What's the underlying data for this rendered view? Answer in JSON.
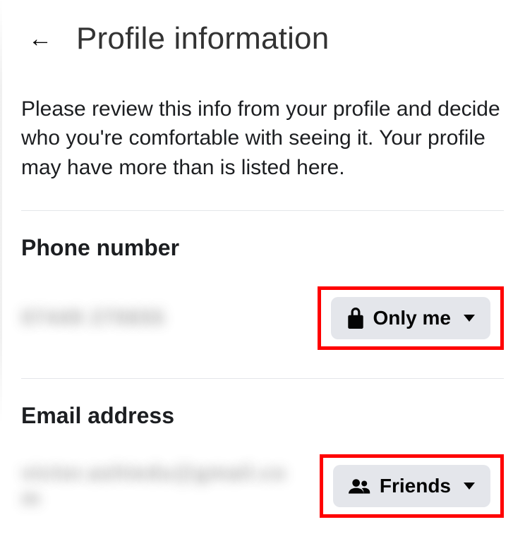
{
  "header": {
    "back": "←",
    "title": "Profile information"
  },
  "description": "Please review this info from your profile and decide who you're comfortable with seeing it. Your profile may have more than is listed here.",
  "sections": {
    "phone": {
      "title": "Phone number",
      "value": "07449 270655",
      "audience_label": "Only me"
    },
    "email": {
      "title": "Email address",
      "value": "victor.ashiedu@gmail.com",
      "audience_label": "Friends"
    }
  }
}
